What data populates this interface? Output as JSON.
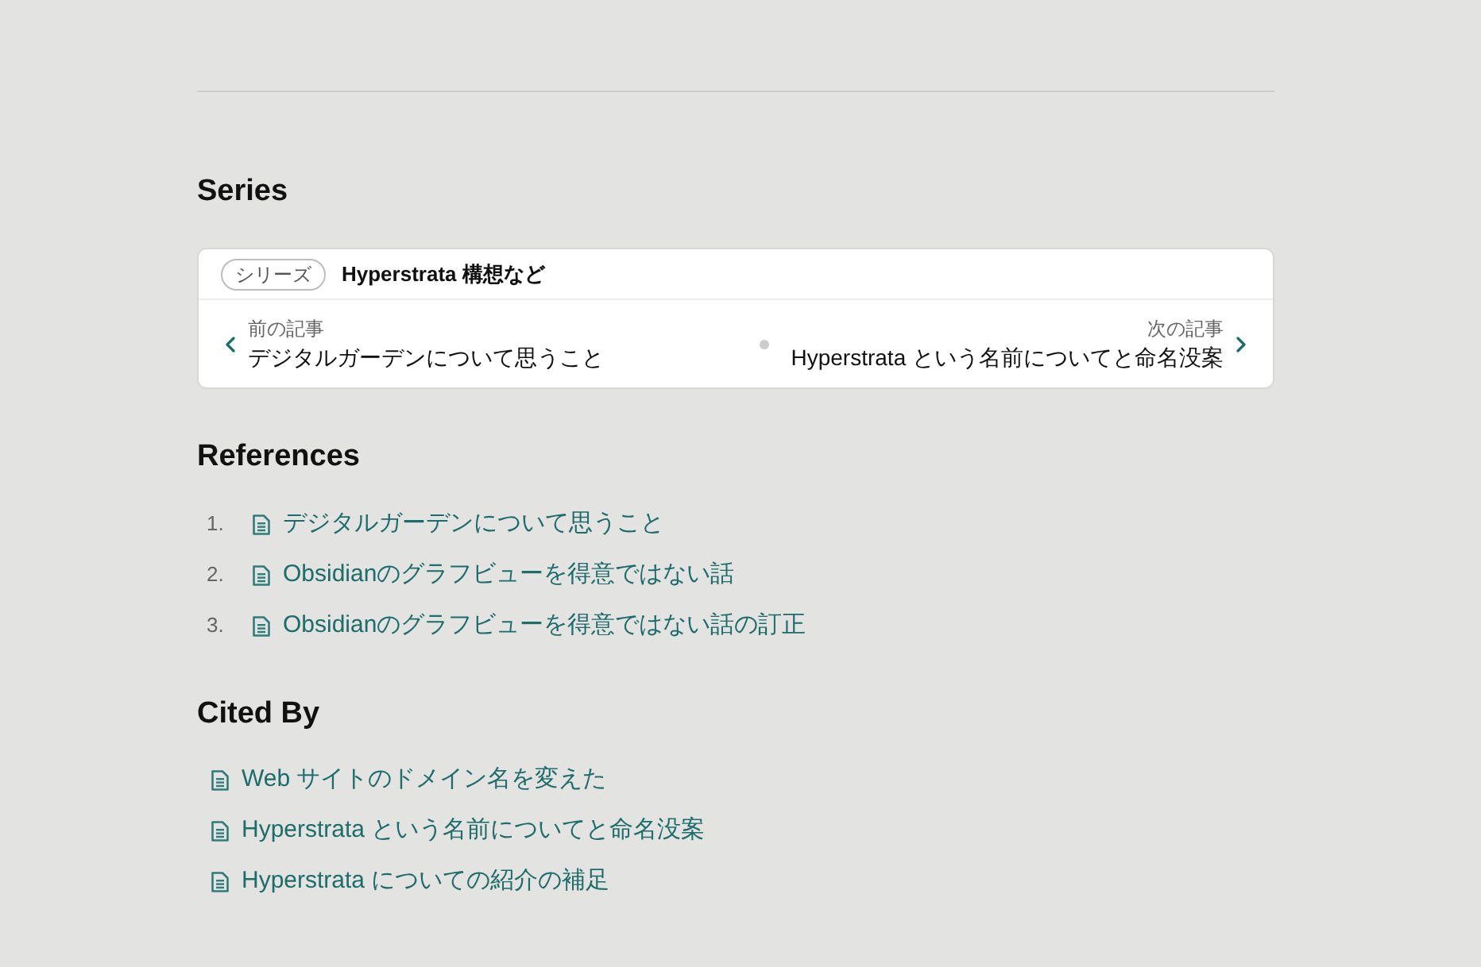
{
  "series": {
    "heading": "Series",
    "badge": "シリーズ",
    "title": "Hyperstrata 構想など",
    "prev": {
      "label": "前の記事",
      "title": "デジタルガーデンについて思うこと"
    },
    "next": {
      "label": "次の記事",
      "title": "Hyperstrata という名前についてと命名没案"
    }
  },
  "references": {
    "heading": "References",
    "items": [
      {
        "number": "1.",
        "title": "デジタルガーデンについて思うこと"
      },
      {
        "number": "2.",
        "title": "Obsidianのグラフビューを得意ではない話"
      },
      {
        "number": "3.",
        "title": "Obsidianのグラフビューを得意ではない話の訂正"
      }
    ]
  },
  "cited_by": {
    "heading": "Cited By",
    "items": [
      {
        "title": "Web サイトのドメイン名を変えた"
      },
      {
        "title": "Hyperstrata という名前についてと命名没案"
      },
      {
        "title": "Hyperstrata についての紹介の補足"
      }
    ]
  }
}
